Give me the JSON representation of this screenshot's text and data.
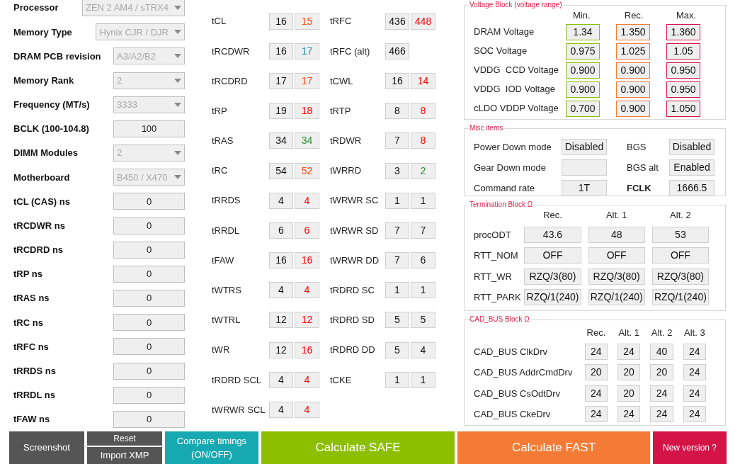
{
  "settings": [
    {
      "label": "Processor",
      "kind": "dropdown",
      "value": "ZEN 2 AM4 / sTRX4"
    },
    {
      "label": "Memory Type",
      "kind": "dropdown",
      "value": "Hynix CJR / DJR"
    },
    {
      "label": "DRAM PCB revision",
      "kind": "dropdown",
      "value": "A3/A2/B2"
    },
    {
      "label": "Memory Rank",
      "kind": "dropdown",
      "value": "2"
    },
    {
      "label": "Frequency (MT/s)",
      "kind": "dropdown",
      "value": "3333"
    },
    {
      "label": "BCLK (100-104.8)",
      "kind": "field",
      "value": "100"
    },
    {
      "label": "DIMM Modules",
      "kind": "dropdown",
      "value": "2"
    },
    {
      "label": "Motherboard",
      "kind": "dropdown",
      "value": "B450 / X470"
    },
    {
      "label": "tCL (CAS) ns",
      "kind": "field",
      "value": "0"
    },
    {
      "label": "tRCDWR ns",
      "kind": "field",
      "value": "0"
    },
    {
      "label": "tRCDRD ns",
      "kind": "field",
      "value": "0"
    },
    {
      "label": "tRP ns",
      "kind": "field",
      "value": "0"
    },
    {
      "label": "tRAS ns",
      "kind": "field",
      "value": "0"
    },
    {
      "label": "tRC ns",
      "kind": "field",
      "value": "0"
    },
    {
      "label": "tRFC ns",
      "kind": "field",
      "value": "0"
    },
    {
      "label": "tRRDS ns",
      "kind": "field",
      "value": "0"
    },
    {
      "label": "tRRDL ns",
      "kind": "field",
      "value": "0"
    },
    {
      "label": "tFAW ns",
      "kind": "field",
      "value": "0"
    }
  ],
  "timings_col1": [
    {
      "label": "tCL",
      "value": "16",
      "alt": {
        "value": "15",
        "color": "#ff4a1a"
      }
    },
    {
      "label": "tRCDWR",
      "value": "16",
      "alt": {
        "value": "17",
        "color": "#1a90a8"
      }
    },
    {
      "label": "tRCDRD",
      "value": "17",
      "alt": {
        "value": "17",
        "color": "#ff4a1a"
      }
    },
    {
      "label": "tRP",
      "value": "19",
      "alt": {
        "value": "18",
        "color": "#ff0000"
      }
    },
    {
      "label": "tRAS",
      "value": "34",
      "alt": {
        "value": "34",
        "color": "#22922a"
      }
    },
    {
      "label": "tRC",
      "value": "54",
      "alt": {
        "value": "52",
        "color": "#ff4a1a"
      }
    },
    {
      "label": "tRRDS",
      "value": "4",
      "alt": {
        "value": "4",
        "color": "#ff0000"
      }
    },
    {
      "label": "tRRDL",
      "value": "6",
      "alt": {
        "value": "6",
        "color": "#ff0000"
      }
    },
    {
      "label": "tFAW",
      "value": "16",
      "alt": {
        "value": "16",
        "color": "#ff0000"
      }
    },
    {
      "label": "tWTRS",
      "value": "4",
      "alt": {
        "value": "4",
        "color": "#ff0000"
      }
    },
    {
      "label": "tWTRL",
      "value": "12",
      "alt": {
        "value": "12",
        "color": "#ff0000"
      }
    },
    {
      "label": "tWR",
      "value": "12",
      "alt": {
        "value": "16",
        "color": "#ff0000"
      }
    },
    {
      "label": "tRDRD SCL",
      "value": "4",
      "alt": {
        "value": "4",
        "color": "#ff0000"
      }
    },
    {
      "label": "tWRWR SCL",
      "value": "4",
      "alt": {
        "value": "4",
        "color": "#ff0000"
      }
    }
  ],
  "timings_col2": [
    {
      "label": "tRFC",
      "value": "436",
      "alt": {
        "value": "448",
        "color": "#ff0000"
      }
    },
    {
      "label": "tRFC (alt)",
      "value": "466"
    },
    {
      "label": "tCWL",
      "value": "16",
      "alt": {
        "value": "14",
        "color": "#ff0000"
      }
    },
    {
      "label": "tRTP",
      "value": "8",
      "alt": {
        "value": "8",
        "color": "#ff0000"
      }
    },
    {
      "label": "tRDWR",
      "value": "7",
      "alt": {
        "value": "8",
        "color": "#ff0000"
      }
    },
    {
      "label": "tWRRD",
      "value": "3",
      "alt": {
        "value": "2",
        "color": "#22922a"
      }
    },
    {
      "label": "tWRWR SC",
      "value": "1",
      "alt": {
        "value": "1",
        "color": "#111111"
      }
    },
    {
      "label": "tWRWR SD",
      "value": "7",
      "alt": {
        "value": "7",
        "color": "#111111"
      }
    },
    {
      "label": "tWRWR DD",
      "value": "7",
      "alt": {
        "value": "6",
        "color": "#111111"
      }
    },
    {
      "label": "tRDRD SC",
      "value": "1",
      "alt": {
        "value": "1",
        "color": "#111111"
      }
    },
    {
      "label": "tRDRD SD",
      "value": "5",
      "alt": {
        "value": "5",
        "color": "#111111"
      }
    },
    {
      "label": "tRDRD DD",
      "value": "5",
      "alt": {
        "value": "4",
        "color": "#111111"
      }
    },
    {
      "label": "tCKE",
      "value": "1",
      "alt": {
        "value": "1",
        "color": "#111111"
      }
    }
  ],
  "voltage_block": {
    "title": "Voltage Block (voltage range)",
    "columns": [
      {
        "label": "Min.",
        "color": "#8cc000"
      },
      {
        "label": "Rec.",
        "color": "#f47b36"
      },
      {
        "label": "Max.",
        "color": "#d41446"
      }
    ],
    "rows": [
      {
        "label": "DRAM Voltage",
        "values": [
          "1.34",
          "1.350",
          "1.360"
        ]
      },
      {
        "label": "SOC Voltage",
        "values": [
          "0.975",
          "1.025",
          "1.05"
        ]
      },
      {
        "label": "VDDG  CCD Voltage",
        "values": [
          "0.900",
          "0.900",
          "0.950"
        ]
      },
      {
        "label": "VDDG  IOD Voltage",
        "values": [
          "0.900",
          "0.900",
          "0.950"
        ]
      },
      {
        "label": "cLDO VDDP Voltage",
        "values": [
          "0.700",
          "0.900",
          "1.050"
        ]
      }
    ]
  },
  "misc_items": {
    "title": "Misc items",
    "rows": [
      [
        {
          "label": "Power Down mode",
          "value": "Disabled",
          "emphasized": false
        },
        {
          "label": "BGS",
          "value": "Disabled",
          "emphasized": false
        }
      ],
      [
        {
          "label": "Gear Down mode",
          "emphasized": false
        },
        {
          "label": "BGS alt",
          "value": "Enabled",
          "emphasized": false
        }
      ],
      [
        {
          "label": "Command rate",
          "value": "1T",
          "emphasized": false
        },
        {
          "label": "FCLK",
          "value": "1666.5",
          "emphasized": true
        }
      ]
    ]
  },
  "termination_block": {
    "title": "Termination Block Ω",
    "columns": [
      "Rec.",
      "Alt. 1",
      "Alt. 2"
    ],
    "rows": [
      {
        "label": "procODT",
        "values": [
          "43.6",
          "48",
          "53"
        ]
      },
      {
        "label": "RTT_NOM",
        "values": [
          "OFF",
          "OFF",
          "OFF"
        ]
      },
      {
        "label": "RTT_WR",
        "values": [
          "RZQ/3(80)",
          "RZQ/3(80)",
          "RZQ/3(80)"
        ]
      },
      {
        "label": "RTT_PARK",
        "values": [
          "RZQ/1(240)",
          "RZQ/1(240)",
          "RZQ/1(240)"
        ]
      }
    ]
  },
  "cad_bus_block": {
    "title": "CAD_BUS Block Ω",
    "columns": [
      "Rec.",
      "Alt. 1",
      "Alt. 2",
      "Alt. 3"
    ],
    "rows": [
      {
        "label": "CAD_BUS ClkDrv",
        "values": [
          "24",
          "24",
          "40",
          "24"
        ]
      },
      {
        "label": "CAD_BUS AddrCmdDrv",
        "values": [
          "20",
          "20",
          "20",
          "24"
        ]
      },
      {
        "label": "CAD_BUS CsOdtDrv",
        "values": [
          "24",
          "20",
          "24",
          "24"
        ]
      },
      {
        "label": "CAD_BUS CkeDrv",
        "values": [
          "24",
          "24",
          "24",
          "24"
        ]
      }
    ]
  },
  "buttons": [
    {
      "label": "Screenshot",
      "kind": "screenshot"
    },
    {
      "label": "Reset",
      "kind": "reset"
    },
    {
      "label": "Import XMP",
      "kind": "import"
    },
    {
      "label": "Compare timings (ON/OFF)",
      "kind": "compare"
    },
    {
      "label": "Calculate SAFE",
      "kind": "safe"
    },
    {
      "label": "Calculate FAST",
      "kind": "fast"
    },
    {
      "label": "New version ?",
      "kind": "new"
    }
  ]
}
